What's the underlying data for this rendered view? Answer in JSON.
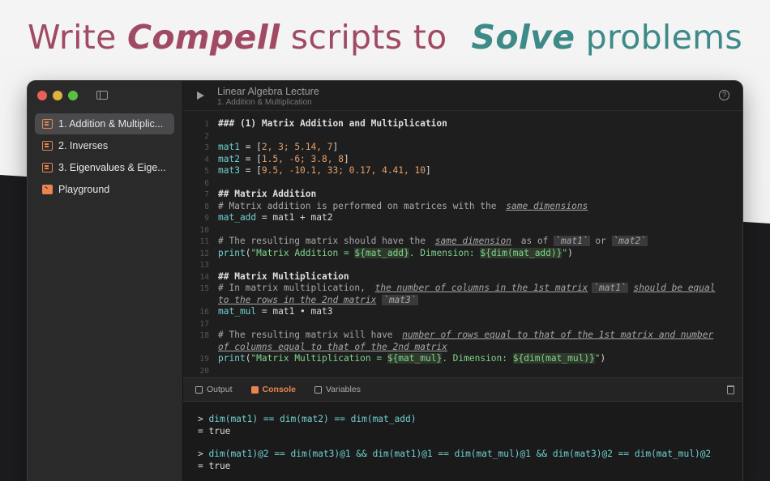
{
  "banner": {
    "part1_pre": "Write ",
    "part1_em": "Compell",
    "part1_post": " scripts to",
    "part2_em": "Solve",
    "part2_post": " problems",
    "color_1": "#a04a64",
    "color_2": "#3d8a88"
  },
  "sidebar": {
    "items": [
      {
        "label": "1. Addition & Multiplic...",
        "icon": "script-icon",
        "active": true
      },
      {
        "label": "2. Inverses",
        "icon": "script-icon",
        "active": false
      },
      {
        "label": "3. Eigenvalues & Eige...",
        "icon": "script-icon",
        "active": false
      },
      {
        "label": "Playground",
        "icon": "terminal-icon",
        "active": false
      }
    ]
  },
  "toolbar": {
    "title": "Linear Algebra Lecture",
    "subtitle": "1. Addition & Multiplication",
    "help_glyph": "?"
  },
  "editor": {
    "line_numbers": [
      "1",
      "2",
      "3",
      "4",
      "5",
      "6",
      "7",
      "8",
      "9",
      "10",
      "11",
      "12",
      "13",
      "14",
      "15",
      "16",
      "17",
      "18",
      "19",
      "20"
    ],
    "l1": "### (1) Matrix Addition and Multiplication",
    "l3_var": "mat1",
    "l3_rest": " = [",
    "l3_vals": "2, 3; 5.14, 7",
    "l3_end": "]",
    "l4_var": "mat2",
    "l4_rest": " = [",
    "l4_vals": "1.5, -6; 3.8, 8",
    "l4_end": "]",
    "l5_var": "mat3",
    "l5_rest": " = [",
    "l5_vals": "9.5, -10.1, 33; 0.17, 4.41, 10",
    "l5_end": "]",
    "l7": "## Matrix Addition",
    "l8_text": "# Matrix addition is performed on matrices with the",
    "l8_link": "same dimensions",
    "l9_var": "mat_add",
    "l9_rest": " = mat1 + mat2",
    "l11_text": "# The resulting matrix should have the",
    "l11_link": "same dimension",
    "l11_mid": " as of ",
    "l11_tick1": "`mat1`",
    "l11_or": " or ",
    "l11_tick2": "`mat2`",
    "l12_fn": "print",
    "l12_a": "(",
    "l12_str1": "\"Matrix Addition = ",
    "l12_int1": "${mat_add}",
    "l12_str2": ". Dimension: ",
    "l12_int2": "${dim(mat_add)}",
    "l12_str3": "\"",
    "l12_b": ")",
    "l14": "## Matrix Multiplication",
    "l15_text": "# In matrix multiplication,",
    "l15_link": "the number of columns in the 1st matrix",
    "l15_tick": "`mat1`",
    "l15_link2": "should be equal",
    "l15w_link": "to the rows in the 2nd matrix",
    "l15w_tick": "`mat3`",
    "l16_var": "mat_mul",
    "l16_rest": " = mat1 • mat3",
    "l18_text": "# The resulting matrix will have",
    "l18_link": "number of rows equal to that of the 1st matrix and number",
    "l18w_link": "of columns equal to that of the 2nd matrix",
    "l19_fn": "print",
    "l19_a": "(",
    "l19_str1": "\"Matrix Multiplication = ",
    "l19_int1": "${mat_mul}",
    "l19_str2": ". Dimension: ",
    "l19_int2": "${dim(mat_mul)}",
    "l19_str3": "\"",
    "l19_b": ")"
  },
  "panel": {
    "tabs": [
      {
        "label": "Output",
        "active": false
      },
      {
        "label": "Console",
        "active": true
      },
      {
        "label": "Variables",
        "active": false
      }
    ]
  },
  "console": {
    "prompt": ">",
    "cmd1": "dim(mat1) == dim(mat2) == dim(mat_add)",
    "res1": "= true",
    "cmd2": "dim(mat1)@2 == dim(mat3)@1 && dim(mat1)@1 == dim(mat_mul)@1 && dim(mat3)@2 == dim(mat_mul)@2",
    "res2": "= true"
  },
  "colors": {
    "accent": "#e8844f",
    "variable": "#6fd1cf",
    "number": "#e6a06b",
    "string": "#7fd48b"
  }
}
